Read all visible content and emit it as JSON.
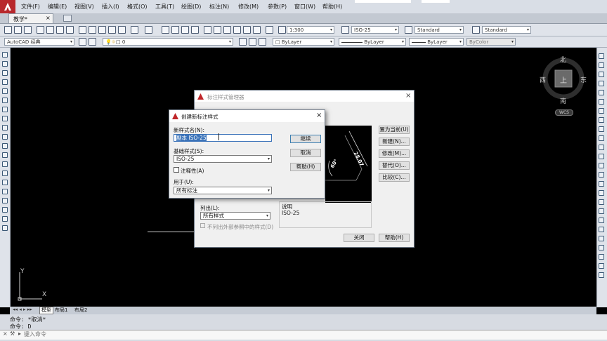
{
  "menu": {
    "items": [
      "文件(F)",
      "编辑(E)",
      "视图(V)",
      "插入(I)",
      "格式(O)",
      "工具(T)",
      "绘图(D)",
      "标注(N)",
      "修改(M)",
      "参数(P)",
      "窗口(W)",
      "帮助(H)"
    ]
  },
  "doc_tab": {
    "title": "教学*"
  },
  "toolbar1": {
    "scale_value": "1:300",
    "dim_style": "ISO-25",
    "text_style": "Standard",
    "table_style": "Standard"
  },
  "toolbar2": {
    "workspace": "AutoCAD 经典",
    "layer": "0",
    "color": "ByLayer",
    "linetype": "ByLayer",
    "lineweight": "ByLayer",
    "plotstyle": "ByColor"
  },
  "viewcube": {
    "north": "北",
    "south": "南",
    "east": "东",
    "west": "西",
    "top": "上",
    "wcs": "WCS"
  },
  "ucs": {
    "y_label": "Y",
    "x_label": "X"
  },
  "layout_tabs": [
    "模型",
    "布局1",
    "布局2"
  ],
  "command": {
    "history": [
      "命令: *取消*",
      "命令: D"
    ],
    "prompt_placeholder": "键入命令"
  },
  "dim_manager": {
    "title": "标注样式管理器",
    "buttons": [
      "置为当前(U)",
      "新建(N)...",
      "修改(M)...",
      "替代(O)...",
      "比较(C)..."
    ],
    "list_label": "列出(L):",
    "list_value": "所有样式",
    "exclude_xref": "不列出外部参照中的样式(D)",
    "description_label": "说明",
    "description_value": "ISO-25",
    "preview_dim_value": "28.07",
    "preview_angle": "60°",
    "close": "关闭",
    "help": "帮助(H)"
  },
  "new_style": {
    "title": "创建新标注样式",
    "name_label": "新样式名(N):",
    "name_value": "副本 ISO-25",
    "base_label": "基础样式(S):",
    "base_value": "ISO-25",
    "annotative_label": "注释性(A)",
    "annotative_checked": false,
    "use_for_label": "用于(U):",
    "use_for_value": "所有标注",
    "continue": "继续",
    "cancel": "取消",
    "help": "帮助(H)"
  }
}
